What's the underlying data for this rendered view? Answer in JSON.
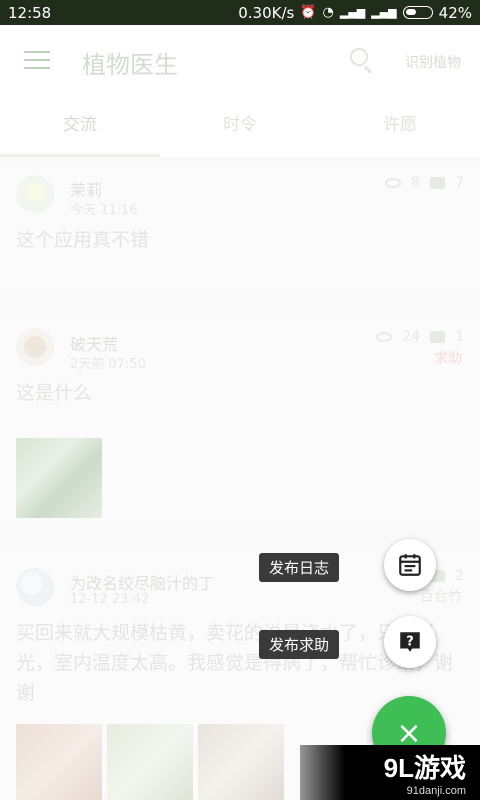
{
  "status_bar": {
    "time": "12:58",
    "speed": "0.30K/s",
    "battery": "42%"
  },
  "app_bar": {
    "title": "植物医生",
    "identify_label": "识别植物"
  },
  "tabs": [
    {
      "label": "交流",
      "active": true
    },
    {
      "label": "时令",
      "active": false
    },
    {
      "label": "许愿",
      "active": false
    }
  ],
  "posts": [
    {
      "name": "茉莉",
      "time": "今天 11:16",
      "text": "这个应用真不错",
      "views": "8",
      "comments": "7",
      "tag": ""
    },
    {
      "name": "破天荒",
      "time": "2天前 07:50",
      "text": "这是什么",
      "views": "24",
      "comments": "1",
      "tag": "求助"
    },
    {
      "name": "为改名绞尽脑汁的丁",
      "time": "12-12 23:42",
      "text": "买回来就大规模枯黄，卖花的说是浇水了，只见阳光，室内温度太高。我感觉是得病了，帮忙诊断，谢谢",
      "views": "",
      "comments": "2",
      "tag": "百合竹"
    }
  ],
  "fab_menu": {
    "diary_label": "发布日志",
    "help_label": "发布求助",
    "close_symbol": "×"
  },
  "watermark": {
    "main": "9L游戏",
    "sub": "91danji.com"
  },
  "colors": {
    "accent": "#3fbe55",
    "statusbar": "#1f2d1a",
    "help_tag": "#f0a8a8"
  }
}
